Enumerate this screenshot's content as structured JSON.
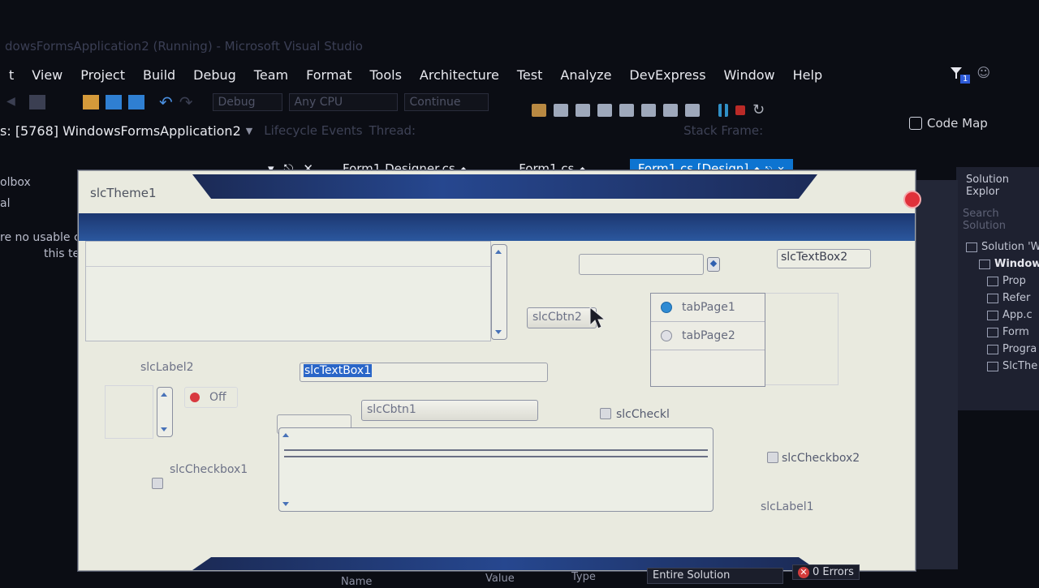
{
  "window": {
    "title": "dowsFormsApplication2 (Running) - Microsoft Visual Studio"
  },
  "menu": [
    "t",
    "View",
    "Project",
    "Build",
    "Debug",
    "Team",
    "Format",
    "Tools",
    "Architecture",
    "Test",
    "Analyze",
    "DevExpress",
    "Window",
    "Help"
  ],
  "notifications": {
    "count": "1"
  },
  "toolbar": {
    "config": "Debug",
    "platform": "Any CPU",
    "continue_label": "Continue"
  },
  "process": {
    "label": "s: [5768] WindowsFormsApplication2",
    "lifecycle": "Lifecycle Events",
    "thread": "Thread:",
    "stack_frame": "Stack Frame:"
  },
  "code_map": {
    "label": "Code Map"
  },
  "toolbox": {
    "title": "olbox",
    "item": "al",
    "message_line1": "re no usable c",
    "message_line2": "this te"
  },
  "doc_tabs": [
    "Form1.Designer.cs",
    "Form1.cs",
    "Form1.cs [Design]"
  ],
  "solution_explorer": {
    "title": "Solution Explor",
    "search": "Search Solution",
    "items": [
      "Solution 'W",
      "Window",
      "Prop",
      "Refer",
      "App.c",
      "Form",
      "Progra",
      "SlcThe"
    ]
  },
  "form": {
    "title": "slcTheme1",
    "textbox2": "slcTextBox2",
    "textbox1": "slcTextBox1",
    "btn2": "slcCbtn2",
    "btn1": "slcCbtn1",
    "label2": "slcLabel2",
    "label1": "slcLabel1",
    "toggle_label": "Off",
    "checkbox1": "slcCheckbox1",
    "checkbox2": "slcCheckbox2",
    "check_label": "slcCheckl",
    "tab_pages": [
      "tabPage1",
      "tabPage2"
    ]
  },
  "bottom": {
    "col_name": "Name",
    "col_value": "Value",
    "col_type": "Type",
    "scope": "Entire Solution",
    "errors": "0 Errors"
  },
  "colors": {
    "accent": "#0d74d1",
    "form_bg": "#e9eadf",
    "header_blue": "#1c3770",
    "close_red": "#e0313a"
  }
}
